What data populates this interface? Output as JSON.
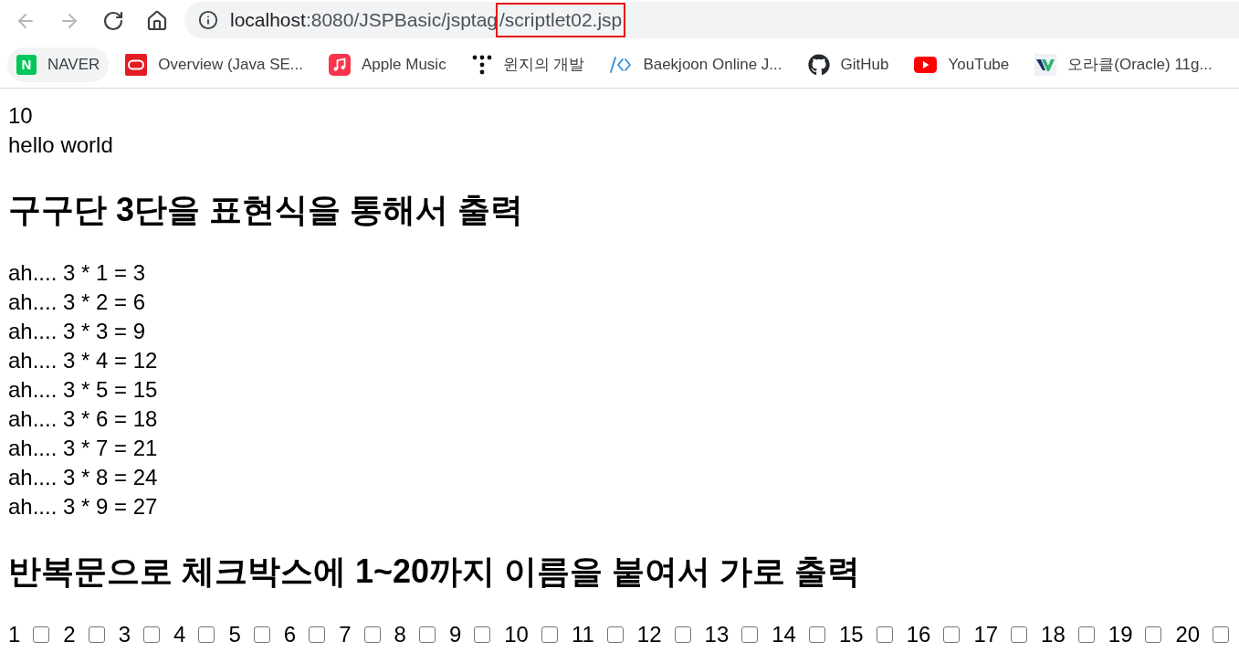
{
  "browser": {
    "nav_buttons": [
      {
        "kind": "back",
        "disabled": true
      },
      {
        "kind": "forward",
        "disabled": true
      },
      {
        "kind": "reload",
        "disabled": false
      },
      {
        "kind": "home",
        "disabled": false
      }
    ],
    "address_bar": {
      "url_parts": [
        {
          "text": "localhost",
          "kind": "host",
          "highlighted": false
        },
        {
          "text": ":8080/JSPBasic/jsptag",
          "kind": "path",
          "highlighted": false
        },
        {
          "text": "/scriptlet02.jsp",
          "kind": "path",
          "highlighted": true
        }
      ]
    },
    "bookmarks": [
      {
        "label": "NAVER",
        "kind": "letter-tile",
        "icon_letter": "N",
        "hovered": true
      },
      {
        "label": "Overview (Java SE...",
        "kind": "ring-tile",
        "hovered": false
      },
      {
        "label": "Apple Music",
        "kind": "music-tile",
        "hovered": false
      },
      {
        "label": "윈지의 개발",
        "kind": "dots",
        "hovered": false
      },
      {
        "label": "Baekjoon Online J...",
        "kind": "code-brackets",
        "hovered": false
      },
      {
        "label": "GitHub",
        "kind": "cat-logo",
        "hovered": false
      },
      {
        "label": "YouTube",
        "kind": "play-tile",
        "hovered": false
      },
      {
        "label": "오라클(Oracle) 11g...",
        "kind": "chevron-logo",
        "hovered": false
      }
    ]
  },
  "page": {
    "lines": [
      "10",
      "hello world"
    ],
    "sections": [
      {
        "heading": "구구단 3단을 표현식을 통해서 출력",
        "lines": [
          "ah.... 3 * 1 = 3",
          "ah.... 3 * 2 = 6",
          "ah.... 3 * 3 = 9",
          "ah.... 3 * 4 = 12",
          "ah.... 3 * 5 = 15",
          "ah.... 3 * 6 = 18",
          "ah.... 3 * 7 = 21",
          "ah.... 3 * 8 = 24",
          "ah.... 3 * 9 = 27"
        ]
      },
      {
        "heading": "반복문으로 체크박스에 1~20까지 이름을 붙여서 가로 출력",
        "checkboxes": [
          {
            "label": "1",
            "checked": false
          },
          {
            "label": "2",
            "checked": false
          },
          {
            "label": "3",
            "checked": false
          },
          {
            "label": "4",
            "checked": false
          },
          {
            "label": "5",
            "checked": false
          },
          {
            "label": "6",
            "checked": false
          },
          {
            "label": "7",
            "checked": false
          },
          {
            "label": "8",
            "checked": false
          },
          {
            "label": "9",
            "checked": false
          },
          {
            "label": "10",
            "checked": false
          },
          {
            "label": "11",
            "checked": false
          },
          {
            "label": "12",
            "checked": false
          },
          {
            "label": "13",
            "checked": false
          },
          {
            "label": "14",
            "checked": false
          },
          {
            "label": "15",
            "checked": false
          },
          {
            "label": "16",
            "checked": false
          },
          {
            "label": "17",
            "checked": false
          },
          {
            "label": "18",
            "checked": false
          },
          {
            "label": "19",
            "checked": false
          },
          {
            "label": "20",
            "checked": false
          }
        ]
      }
    ]
  }
}
